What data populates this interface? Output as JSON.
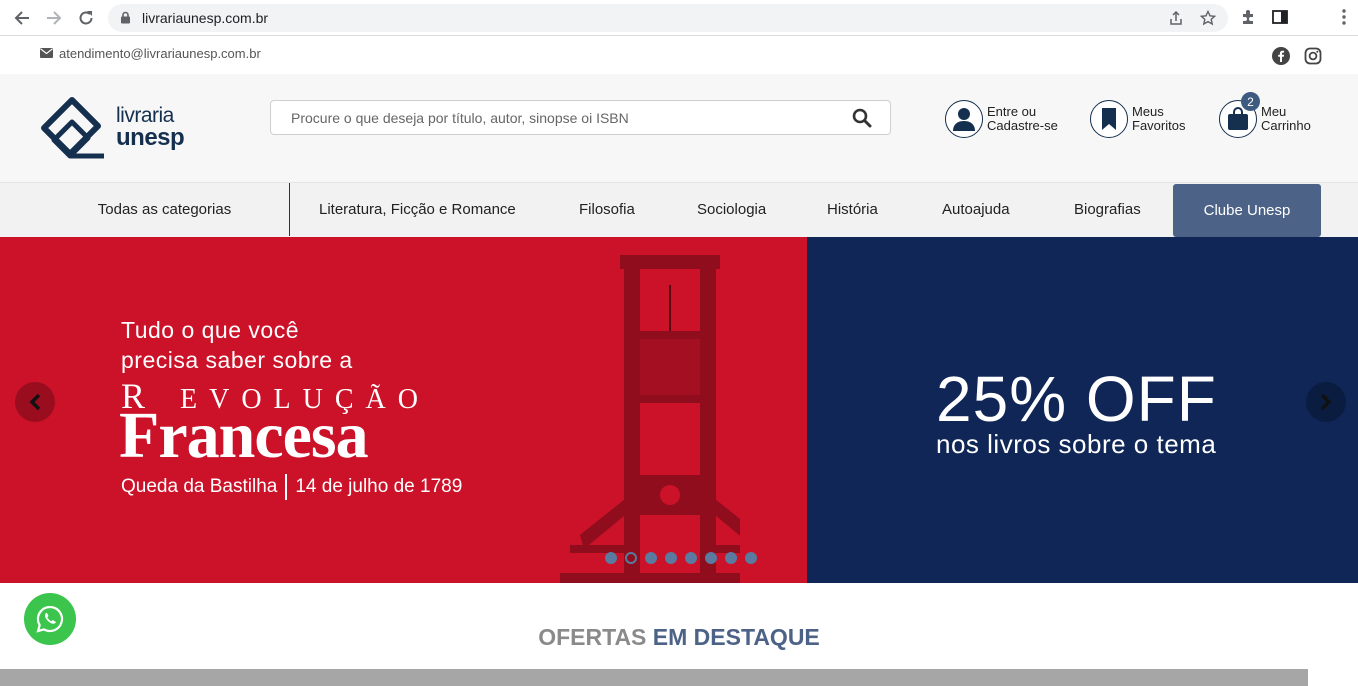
{
  "browser": {
    "url": "livrariaunesp.com.br"
  },
  "topbar": {
    "email": "atendimento@livrariaunesp.com.br"
  },
  "logo": {
    "line1": "livraria",
    "line2": "unesp"
  },
  "search": {
    "placeholder": "Procure o que deseja por título, autor, sinopse oi ISBN"
  },
  "header_actions": {
    "account": {
      "line1": "Entre ou",
      "line2": "Cadastre-se"
    },
    "favorites": {
      "line1": "Meus",
      "line2": "Favoritos"
    },
    "cart": {
      "line1": "Meu",
      "line2": "Carrinho",
      "count": "2"
    }
  },
  "categories": {
    "all_label": "Todas as categorias",
    "items": [
      "Literatura, Ficção e Romance",
      "Filosofia",
      "Sociologia",
      "História",
      "Autoajuda",
      "Biografias"
    ],
    "club_label": "Clube Unesp"
  },
  "banner": {
    "intro_line1": "Tudo o que você",
    "intro_line2": "precisa saber sobre a",
    "rev_first": "R",
    "rev_rest": "EVOLUÇÃO",
    "title": "Francesa",
    "sub_left": "Queda da Bastilha",
    "sub_right": "14 de julho de 1789",
    "offer_big": "25% OFF",
    "offer_small": "nos livros sobre o tema",
    "slides_total": 8,
    "active_slide": 2
  },
  "offers": {
    "word1": "OFERTAS",
    "word2": "EM DESTAQUE"
  },
  "colors": {
    "brand_navy": "#15304f",
    "club_button": "#4c6287",
    "banner_red": "#cc1229",
    "banner_blue": "#0f2657",
    "whatsapp_green": "#3cc54c"
  }
}
